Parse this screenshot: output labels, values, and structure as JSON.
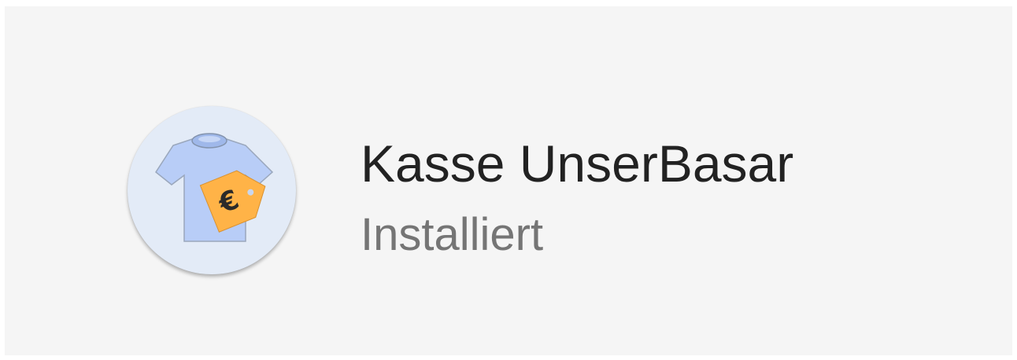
{
  "app": {
    "name": "Kasse UnserBasar",
    "status": "Installiert",
    "icon": "shirt-price-tag-icon"
  },
  "colors": {
    "card_background": "#f5f5f5",
    "icon_background": "#e3ebf7",
    "shirt": "#b8cdf7",
    "tag": "#ffb347",
    "title_text": "#222222",
    "status_text": "#757575"
  }
}
